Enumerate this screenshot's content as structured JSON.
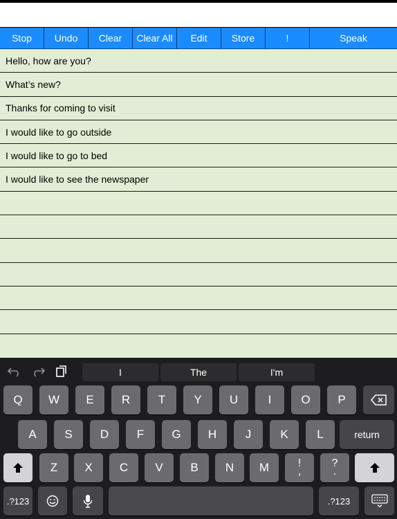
{
  "toolbar": {
    "buttons": [
      "Stop",
      "Undo",
      "Clear",
      "Clear All",
      "Edit",
      "Store",
      "!",
      "Speak"
    ]
  },
  "phrases": [
    "Hello, how are you?",
    "What’s new?",
    "Thanks for coming to visit",
    "I would like to go outside",
    "I would like to go to bed",
    "I would like to see the newspaper",
    "",
    "",
    "",
    "",
    "",
    "",
    ""
  ],
  "keyboard": {
    "suggestions": [
      "I",
      "The",
      "I'm"
    ],
    "row1": [
      "Q",
      "W",
      "E",
      "R",
      "T",
      "Y",
      "U",
      "I",
      "O",
      "P"
    ],
    "row2": [
      "A",
      "S",
      "D",
      "F",
      "G",
      "H",
      "J",
      "K",
      "L"
    ],
    "row3": [
      "Z",
      "X",
      "C",
      "V",
      "B",
      "N",
      "M"
    ],
    "return_label": "return",
    "numbers_label": ".?123",
    "punct1_top": "!",
    "punct1_bottom": ",",
    "punct2_top": "?",
    "punct2_bottom": ".",
    "icons": [
      "undo-icon",
      "redo-icon",
      "paste-icon",
      "backspace-icon",
      "shift-icon",
      "emoji-icon",
      "microphone-icon",
      "keyboard-hide-icon"
    ]
  }
}
